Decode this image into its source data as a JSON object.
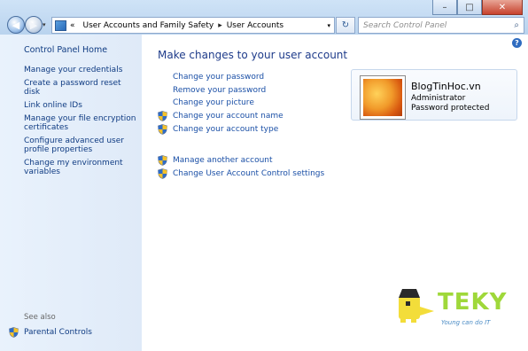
{
  "window": {
    "minimize_glyph": "–",
    "maximize_glyph": "□",
    "close_glyph": "✕"
  },
  "nav": {
    "back_glyph": "◀",
    "forward_glyph": "▶",
    "dropdown_glyph": "▾"
  },
  "address": {
    "chevrons": "«",
    "crumb_1": "User Accounts and Family Safety",
    "separator": "▸",
    "crumb_2": "User Accounts",
    "dropdown_glyph": "▾"
  },
  "refresh_glyph": "↻",
  "search": {
    "placeholder": "Search Control Panel",
    "icon": "magnifier-icon",
    "icon_glyph": "⌕"
  },
  "sidebar": {
    "home": "Control Panel Home",
    "links": [
      "Manage your credentials",
      "Create a password reset disk",
      "Link online IDs",
      "Manage your file encryption certificates",
      "Configure advanced user profile properties",
      "Change my environment variables"
    ],
    "see_also_label": "See also",
    "parental_controls": "Parental Controls"
  },
  "help_glyph": "?",
  "main": {
    "title": "Make changes to your user account",
    "tasks": [
      "Change your password",
      "Remove your password",
      "Change your picture",
      "Change your account name",
      "Change your account type"
    ],
    "other_tasks": [
      "Manage another account",
      "Change User Account Control settings"
    ]
  },
  "account": {
    "name": "BlogTinHoc.vn",
    "role": "Administrator",
    "status": "Password protected"
  },
  "watermark": {
    "brand": "TEKY",
    "tagline": "Young can do IT"
  },
  "colors": {
    "link": "#1a4fa6",
    "title": "#1e3b8a",
    "sidebar_bg": "#e2ecf9",
    "brand_green": "#9fd83a"
  }
}
